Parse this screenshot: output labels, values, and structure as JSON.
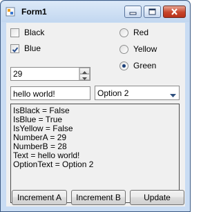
{
  "window": {
    "title": "Form1"
  },
  "checkboxes": [
    {
      "label": "Black",
      "checked": false
    },
    {
      "label": "Blue",
      "checked": true
    }
  ],
  "radios": [
    {
      "label": "Red",
      "selected": false
    },
    {
      "label": "Yellow",
      "selected": false
    },
    {
      "label": "Green",
      "selected": true
    }
  ],
  "numeric": {
    "value": "29"
  },
  "textbox": {
    "value": "hello world!"
  },
  "combo": {
    "selected": "Option 2"
  },
  "output": {
    "lines": [
      "IsBlack = False",
      "IsBlue = True",
      "IsYellow = False",
      "NumberA = 29",
      "NumberB = 28",
      "Text = hello world!",
      "OptionText = Option 2"
    ]
  },
  "buttons": {
    "increment_a": "Increment A",
    "increment_b": "Increment B",
    "update": "Update"
  },
  "icons": {
    "app": "form-icon",
    "minimize": "minimize-icon",
    "maximize": "maximize-icon",
    "close": "close-icon",
    "check": "check-icon",
    "spin_up": "arrow-up-icon",
    "spin_down": "arrow-down-icon",
    "dropdown": "chevron-down-icon"
  },
  "colors": {
    "titlebar": "#c9dcf3",
    "client": "#f0f0f0",
    "check": "#2a4f8e",
    "radio_dot": "#1a3e79"
  }
}
